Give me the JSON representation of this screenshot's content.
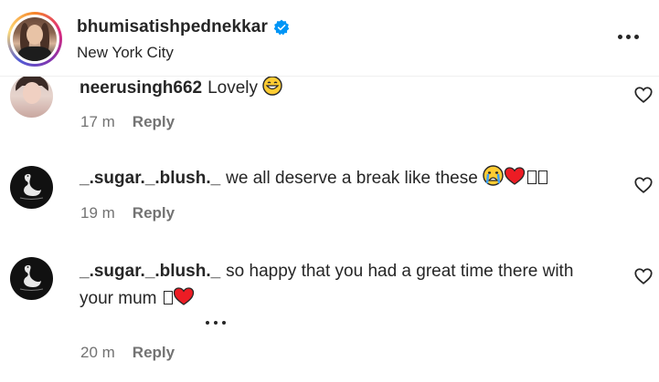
{
  "header": {
    "username": "bhumisatishpednekkar",
    "location": "New York City",
    "verified_icon": "verified-badge-icon",
    "more_icon": "more-options-icon"
  },
  "comments": [
    {
      "username": "neerusingh662",
      "text": "Lovely",
      "emojis": [
        "grinning-face-icon"
      ],
      "time": "17 m",
      "reply_label": "Reply"
    },
    {
      "username": "_.sugar._.blush._",
      "text": "we all deserve a break like these",
      "emojis": [
        "crying-face-icon",
        "red-heart-icon"
      ],
      "time": "19 m",
      "reply_label": "Reply"
    },
    {
      "username": "_.sugar._.blush._",
      "text_line1": "so happy that you had a great time there with",
      "text_line2": "your mum",
      "emojis": [
        "red-heart-icon"
      ],
      "time": "20 m",
      "reply_label": "Reply"
    }
  ],
  "colors": {
    "text": "#262626",
    "secondary": "#737373",
    "verified": "#0095f6",
    "heart": "#ed1c24"
  }
}
